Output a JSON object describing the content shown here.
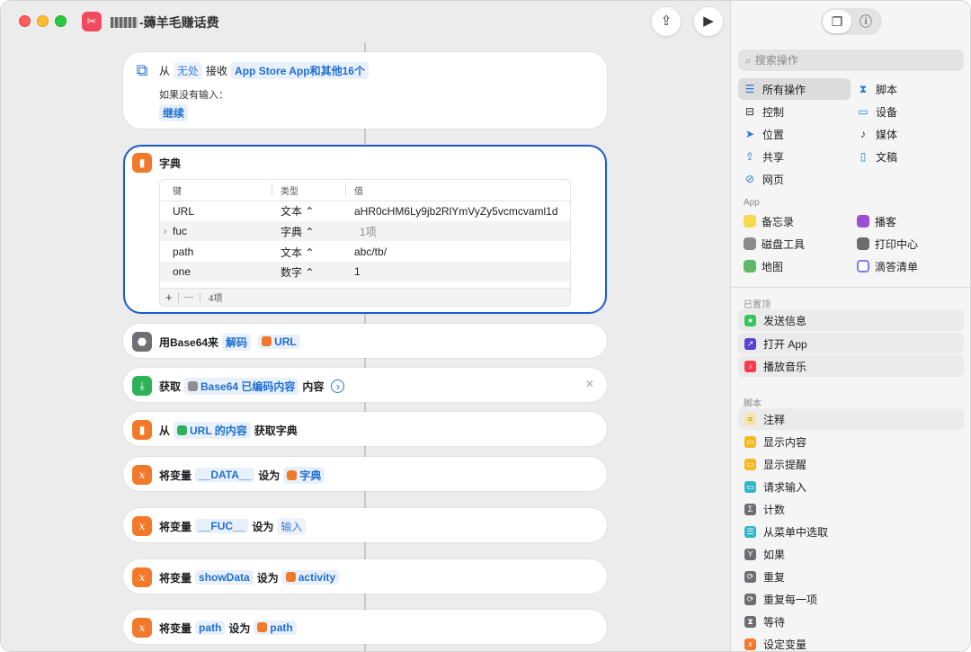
{
  "window": {
    "title": "-薅羊毛赚话费"
  },
  "card_receive": {
    "from": "从",
    "source": "无处",
    "receive": "接收",
    "types": "App Store App和其他16个",
    "no_input_label": "如果没有输入：",
    "no_input_value": "继续"
  },
  "dict_card": {
    "title": "字典",
    "headers": [
      "键",
      "类型",
      "值"
    ],
    "rows": [
      {
        "key": "URL",
        "type": "文本 ⌃",
        "value": "aHR0cHM6Ly9jb2RlYmVyZy5vcmcvaml1d"
      },
      {
        "key": "fuc",
        "type": "字典 ⌃",
        "value": "1项"
      },
      {
        "key": "path",
        "type": "文本 ⌃",
        "value": "abc/tb/"
      },
      {
        "key": "one",
        "type": "数字 ⌃",
        "value": "1"
      }
    ],
    "footer_add": "+",
    "footer_remove": "—",
    "footer_count": "4项"
  },
  "actions": [
    {
      "pre": "用Base64来",
      "t1": "解码",
      "t2": "URL"
    },
    {
      "pre": "获取",
      "t1": "Base64 已编码内容",
      "post": "内容"
    },
    {
      "pre": "从",
      "t1": "URL 的内容",
      "post": "获取字典"
    },
    {
      "pre": "将变量",
      "t1": "__DATA__",
      "mid": "设为",
      "t2": "字典"
    },
    {
      "pre": "将变量",
      "t1": "__FUC__",
      "mid": "设为",
      "t2": "输入"
    },
    {
      "pre": "将变量",
      "t1": "showData",
      "mid": "设为",
      "t2": "activity"
    },
    {
      "pre": "将变量",
      "t1": "path",
      "mid": "设为",
      "t2": "path"
    }
  ],
  "sidebar": {
    "search_placeholder": "搜索操作",
    "categories": [
      "所有操作",
      "脚本",
      "控制",
      "设备",
      "位置",
      "媒体",
      "共享",
      "文稿",
      "网页"
    ],
    "app_section": "App",
    "apps": [
      "备忘录",
      "播客",
      "磁盘工具",
      "打印中心",
      "地图",
      "滴答清单"
    ],
    "pinned_section": "已置顶",
    "pinned": [
      "发送信息",
      "打开 App",
      "播放音乐"
    ],
    "script_section": "脚本",
    "scripts": [
      "注释",
      "显示内容",
      "显示提醒",
      "请求输入",
      "计数",
      "从菜单中选取",
      "如果",
      "重复",
      "重复每一项",
      "等待",
      "设定变量"
    ]
  },
  "colors": {
    "accent": "#1f6fd1",
    "action_orange": "#f2792a",
    "selection_border": "#1b5fc8"
  }
}
